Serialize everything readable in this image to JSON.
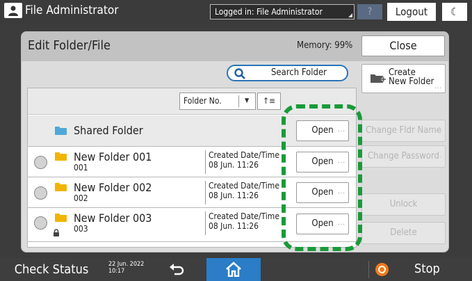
{
  "topbar": {
    "user_title": "File Administrator",
    "login_status": "Logged in: File Administrator",
    "help_label": "?",
    "logout_label": "Logout",
    "moon_label": "☾"
  },
  "dialog": {
    "title": "Edit Folder/File",
    "memory": "Memory:  99%",
    "close_label": "Close",
    "search_label": "Search Folder",
    "create_label_1": "Create",
    "create_label_2": "New Folder",
    "sort": {
      "selected": "Folder No.",
      "order_symbol": "↑≡"
    },
    "shared_folder": {
      "name": "Shared Folder",
      "open_label": "Open"
    },
    "folders": [
      {
        "name": "New Folder 001",
        "number": "001",
        "date_label": "Created Date/Time",
        "date": "08 Jun.  11:26",
        "open_label": "Open",
        "locked": false
      },
      {
        "name": "New Folder 002",
        "number": "002",
        "date_label": "Created Date/Time",
        "date": "08 Jun.  11:26",
        "open_label": "Open",
        "locked": false
      },
      {
        "name": "New Folder 003",
        "number": "003",
        "date_label": "Created Date/Time",
        "date": "08 Jun.  11:26",
        "open_label": "Open",
        "locked": true
      }
    ],
    "side_buttons": {
      "change_name": "Change Fldr Name",
      "change_password": "Change Password",
      "unlock": "Unlock",
      "delete": "Delete"
    }
  },
  "bottombar": {
    "check_status": "Check Status",
    "date": "22 Jun. 2022",
    "time": "10:17",
    "stop_label": "Stop"
  },
  "colors": {
    "accent_blue": "#2a7dc6",
    "highlight_green": "#1a9a3a",
    "folder_yellow": "#f2b400",
    "shared_folder_blue": "#4fa8d8",
    "stop_orange": "#f07820"
  }
}
